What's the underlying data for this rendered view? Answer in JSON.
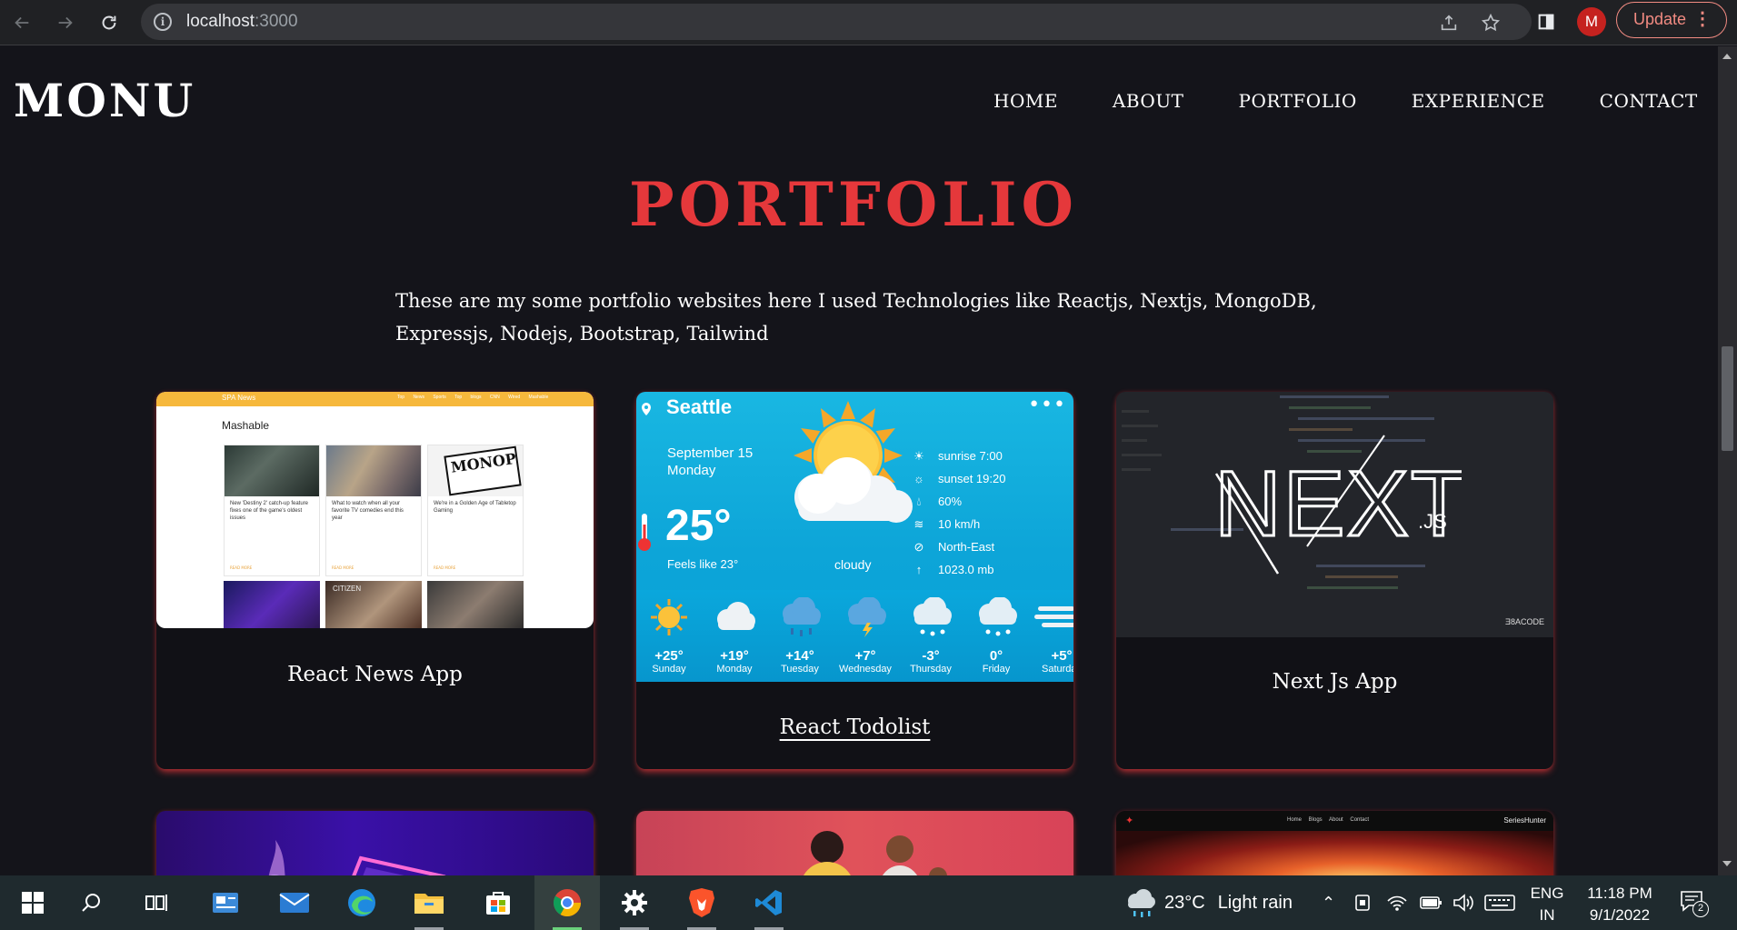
{
  "browser": {
    "url_host": "localhost",
    "url_port": ":3000",
    "profile_initial": "M",
    "update_label": "Update"
  },
  "site": {
    "logo": "MONU",
    "nav": [
      "HOME",
      "ABOUT",
      "PORTFOLIO",
      "EXPERIENCE",
      "CONTACT"
    ],
    "section_title": "PORTFOLIO",
    "intro": "These are my some portfolio websites here I used Technologies like Reactjs, Nextjs, MongoDB, Expressjs, Nodejs, Bootstrap, Tailwind"
  },
  "cards": [
    {
      "caption": "React News App",
      "thumb": {
        "brand": "SPA News",
        "links": "Top News Sports Top blogs CNN Wired Mashable",
        "heading": "Mashable",
        "items": [
          "New 'Destiny 2' catch-up feature fixes one of the game's oldest issues",
          "What to watch when all your favorite TV comedies end this year",
          "We're in a Golden Age of Tabletop Gaming"
        ],
        "more": "READ MORE",
        "tile_texts": [
          "CITIZEN",
          "MONOPOLY"
        ]
      }
    },
    {
      "caption": "React Todolist",
      "thumb": {
        "city": "Seattle",
        "date_line1": "September 15",
        "date_line2": "Monday",
        "temp": "25°",
        "feels": "Feels like 23°",
        "condition": "cloudy",
        "stats": [
          "sunrise 7:00",
          "sunset 19:20",
          "60%",
          "10 km/h",
          "North-East",
          "1023.0 mb"
        ],
        "forecast": [
          {
            "temp": "+25°",
            "day": "Sunday"
          },
          {
            "temp": "+19°",
            "day": "Monday"
          },
          {
            "temp": "+14°",
            "day": "Tuesday"
          },
          {
            "temp": "+7°",
            "day": "Wednesday"
          },
          {
            "temp": "-3°",
            "day": "Thursday"
          },
          {
            "temp": "0°",
            "day": "Friday"
          },
          {
            "temp": "+5°",
            "day": "Saturday"
          }
        ]
      }
    },
    {
      "caption": "Next Js App",
      "thumb": {
        "logo_main": "NEXT",
        "logo_suffix": ".JS",
        "watermark": "Ǝ8ACODE"
      }
    },
    {
      "caption": "",
      "thumb": {}
    },
    {
      "caption": "",
      "thumb": {}
    },
    {
      "caption": "",
      "thumb": {
        "links": "Home Blogs About Contact",
        "brand": "SeriesHunter"
      }
    }
  ],
  "taskbar": {
    "weather_temp": "23°C",
    "weather_text": "Light rain",
    "lang_1": "ENG",
    "lang_2": "IN",
    "time": "11:18 PM",
    "date": "9/1/2022",
    "notifications": "2"
  }
}
